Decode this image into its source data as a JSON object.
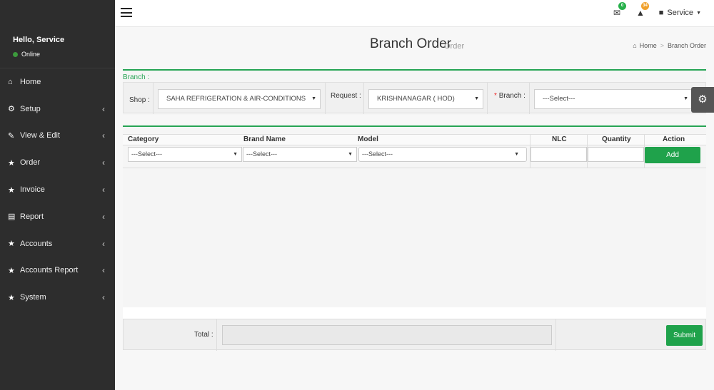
{
  "sidebar": {
    "greeting": "Hello, Service",
    "status": "Online",
    "items": [
      {
        "label": "Home",
        "icon": "home-icon",
        "chevron": false
      },
      {
        "label": "Setup",
        "icon": "cogs-icon",
        "chevron": true
      },
      {
        "label": "View & Edit",
        "icon": "edit-icon",
        "chevron": true
      },
      {
        "label": "Order",
        "icon": "star-icon",
        "chevron": true
      },
      {
        "label": "Invoice",
        "icon": "star-icon",
        "chevron": true
      },
      {
        "label": "Report",
        "icon": "file-icon",
        "chevron": true
      },
      {
        "label": "Accounts",
        "icon": "star-icon",
        "chevron": true
      },
      {
        "label": "Accounts Report",
        "icon": "star-icon",
        "chevron": true
      },
      {
        "label": "System",
        "icon": "star-icon",
        "chevron": true
      }
    ]
  },
  "topbar": {
    "mail_badge": "0",
    "alert_badge": "34",
    "user_label": "Service"
  },
  "header": {
    "title": "Branch Order",
    "subtitle": "Order",
    "breadcrumb_home": "Home",
    "breadcrumb_current": "Branch Order"
  },
  "branch_panel": {
    "title": "Branch :",
    "shop_label": "Shop :",
    "shop_value": "SAHA REFRIGERATION & AIR-CONDITIONS",
    "request_label": "Request :",
    "request_value": "KRISHNANAGAR ( HOD)",
    "branch_required": "*",
    "branch_label": "Branch :",
    "branch_value": "---Select---"
  },
  "order_table": {
    "columns": [
      "Category",
      "Brand Name",
      "Model",
      "NLC",
      "Quantity",
      "Action"
    ],
    "category_value": "---Select---",
    "brand_value": "---Select---",
    "model_value": "---Select---",
    "add_label": "Add"
  },
  "footer": {
    "total_label": "Total :",
    "submit_label": "Submit"
  },
  "colors": {
    "accent_green": "#1fa24b",
    "sidebar_bg": "#2d2d2d",
    "badge_green": "#26b04a",
    "badge_orange": "#f0a02a"
  }
}
